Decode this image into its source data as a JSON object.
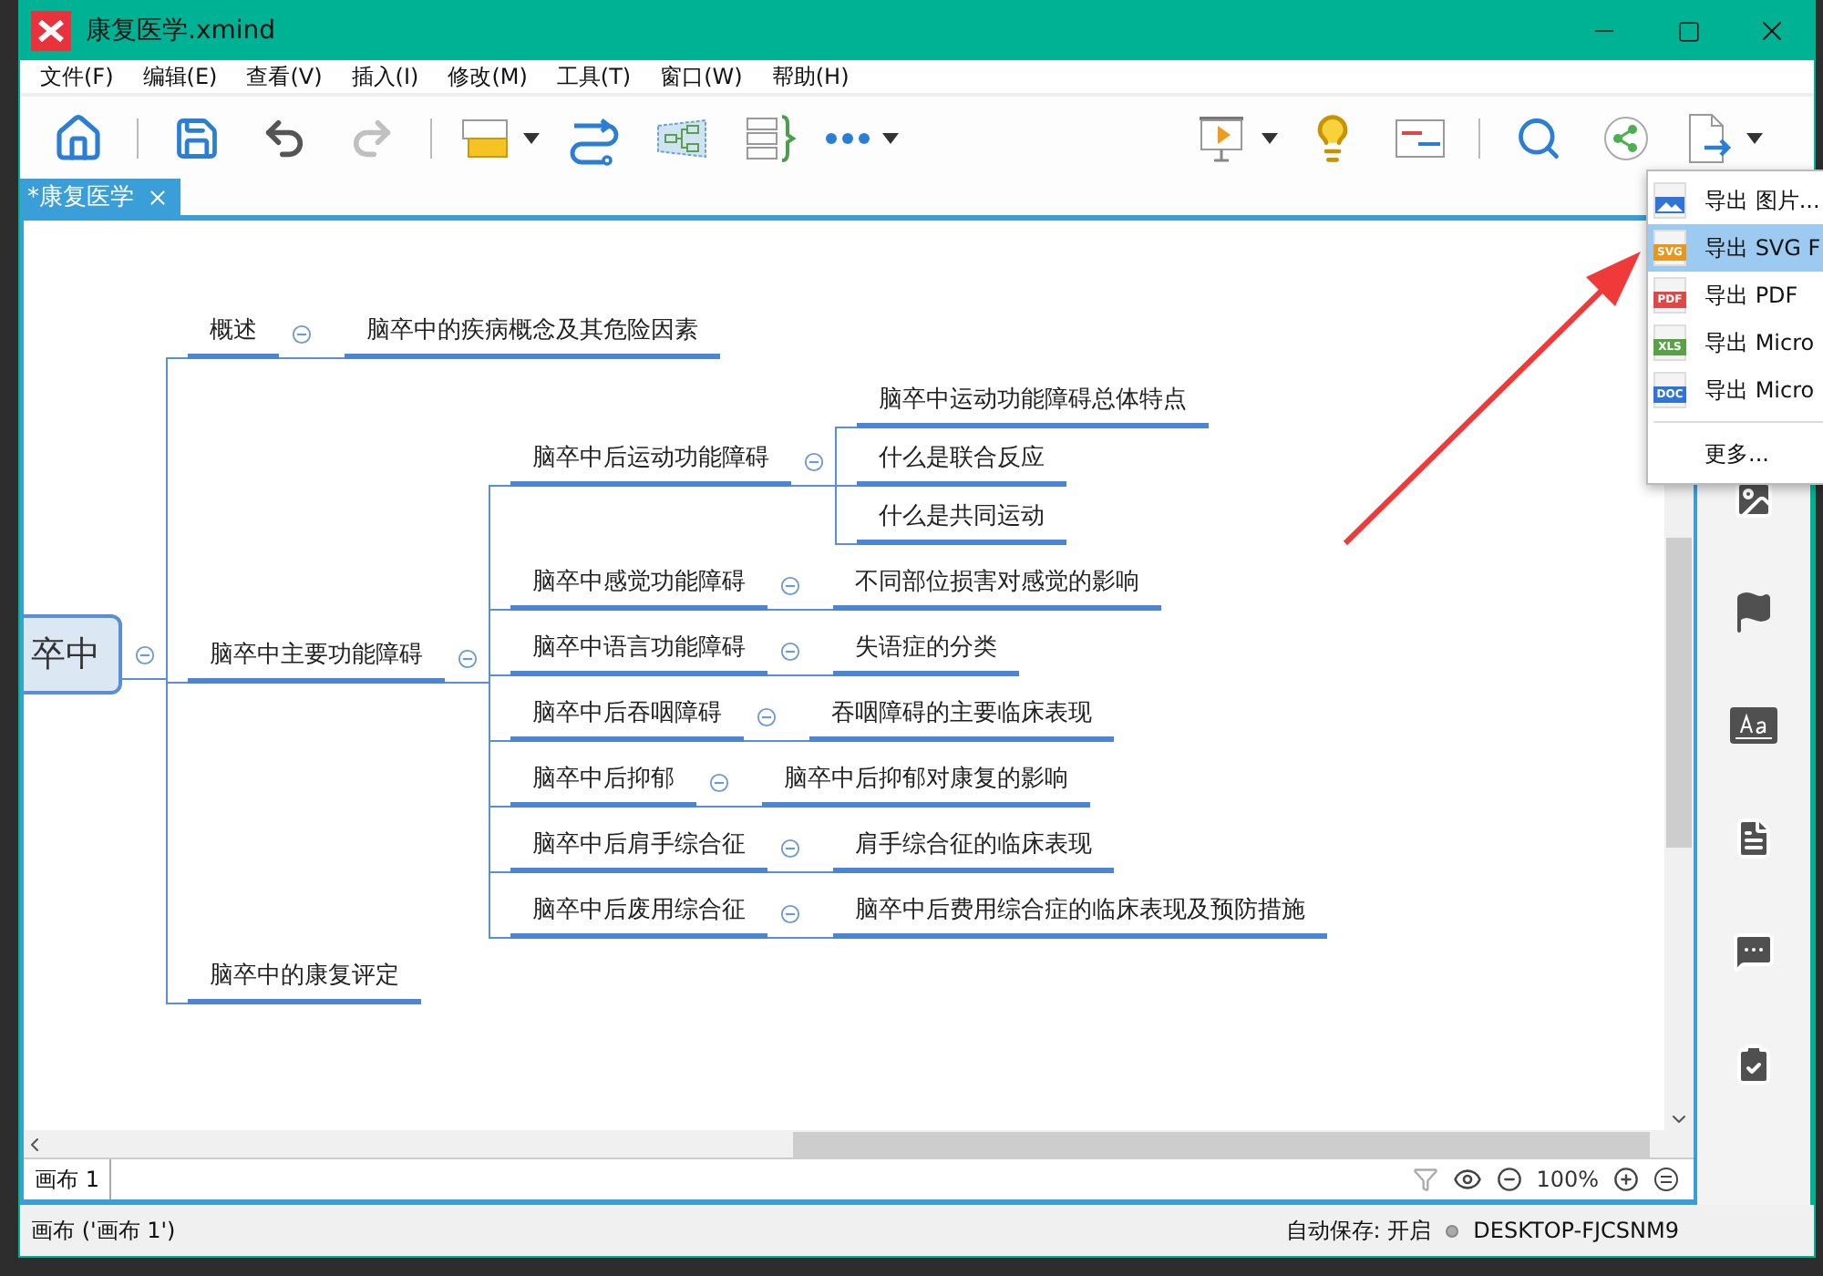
{
  "window": {
    "title": "康复医学.xmind"
  },
  "menu": [
    "文件(F)",
    "编辑(E)",
    "查看(V)",
    "插入(I)",
    "修改(M)",
    "工具(T)",
    "窗口(W)",
    "帮助(H)"
  ],
  "toolbar": {
    "left": [
      {
        "kind": "home",
        "dropdown": false,
        "disabled": false
      },
      {
        "kind": "separator"
      },
      {
        "kind": "save",
        "dropdown": false,
        "disabled": false
      },
      {
        "kind": "undo",
        "dropdown": false,
        "disabled": false
      },
      {
        "kind": "redo",
        "dropdown": false,
        "disabled": true
      },
      {
        "kind": "separator"
      },
      {
        "kind": "topic",
        "dropdown": true,
        "disabled": false
      },
      {
        "kind": "relationship",
        "dropdown": false,
        "disabled": false
      },
      {
        "kind": "boundary",
        "dropdown": false,
        "disabled": false
      },
      {
        "kind": "summary",
        "dropdown": false,
        "disabled": false
      },
      {
        "kind": "more",
        "dropdown": true,
        "disabled": false
      }
    ],
    "right": [
      {
        "kind": "presentation",
        "dropdown": true,
        "disabled": false
      },
      {
        "kind": "idea",
        "dropdown": false,
        "disabled": false
      },
      {
        "kind": "gantt",
        "dropdown": false,
        "disabled": false
      },
      {
        "kind": "separator"
      },
      {
        "kind": "search",
        "dropdown": false,
        "disabled": false
      },
      {
        "kind": "share",
        "dropdown": false,
        "disabled": false
      },
      {
        "kind": "export",
        "dropdown": true,
        "disabled": false
      }
    ]
  },
  "document_tab": {
    "label": "*康复医学",
    "selected": true
  },
  "mind_map": {
    "root": {
      "label": "卒中",
      "collapsed": false,
      "children": [
        {
          "label": "概述",
          "collapsed": false,
          "children": [
            {
              "label": "脑卒中的疾病概念及其危险因素"
            }
          ]
        },
        {
          "label": "脑卒中主要功能障碍",
          "collapsed": false,
          "children": [
            {
              "label": "脑卒中后运动功能障碍",
              "collapsed": false,
              "children": [
                {
                  "label": "脑卒中运动功能障碍总体特点"
                },
                {
                  "label": "什么是联合反应"
                },
                {
                  "label": "什么是共同运动"
                }
              ]
            },
            {
              "label": "脑卒中感觉功能障碍",
              "collapsed": false,
              "children": [
                {
                  "label": "不同部位损害对感觉的影响"
                }
              ]
            },
            {
              "label": "脑卒中语言功能障碍",
              "collapsed": false,
              "children": [
                {
                  "label": "失语症的分类"
                }
              ]
            },
            {
              "label": "脑卒中后吞咽障碍",
              "collapsed": false,
              "children": [
                {
                  "label": "吞咽障碍的主要临床表现"
                }
              ]
            },
            {
              "label": "脑卒中后抑郁",
              "collapsed": false,
              "children": [
                {
                  "label": "脑卒中后抑郁对康复的影响"
                }
              ]
            },
            {
              "label": "脑卒中后肩手综合征",
              "collapsed": false,
              "children": [
                {
                  "label": "肩手综合征的临床表现"
                }
              ]
            },
            {
              "label": "脑卒中后废用综合征",
              "collapsed": false,
              "children": [
                {
                  "label": "脑卒中后费用综合症的临床表现及预防措施"
                }
              ]
            }
          ]
        },
        {
          "label": "脑卒中的康复评定"
        }
      ]
    }
  },
  "export_menu": [
    {
      "kind": "image",
      "label": "导出 图片...",
      "selected": false
    },
    {
      "kind": "svg",
      "icon_text": "SVG",
      "label": "导出 SVG F",
      "selected": true
    },
    {
      "kind": "pdf",
      "icon_text": "PDF",
      "label": "导出 PDF",
      "selected": false
    },
    {
      "kind": "xls",
      "icon_text": "XLS",
      "label": "导出 Micro",
      "selected": false
    },
    {
      "kind": "doc",
      "icon_text": "DOC",
      "label": "导出 Micro",
      "selected": false
    },
    {
      "kind": "more",
      "label": "更多...",
      "selected": false
    }
  ],
  "sheet_tabs": [
    {
      "label": "画布 1",
      "selected": true
    }
  ],
  "zoom": "100%",
  "status_bar": {
    "left": "画布 ('画布 1')",
    "autosave": "自动保存: 开启",
    "computer": "DESKTOP-FJCSNM9"
  }
}
